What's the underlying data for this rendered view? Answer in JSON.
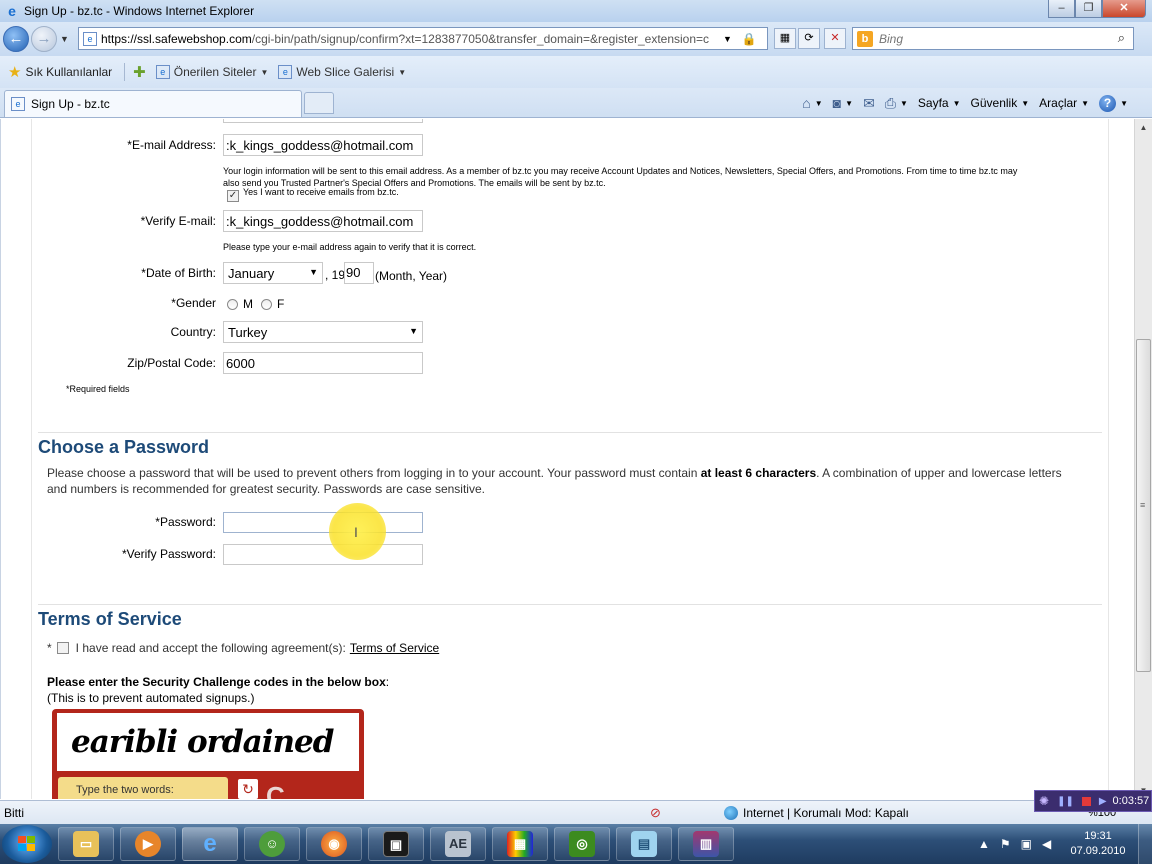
{
  "window": {
    "title": "Sign Up - bz.tc - Windows Internet Explorer",
    "minimize": "‒",
    "restore": "❐",
    "close": "✕"
  },
  "address_bar": {
    "url_host": "https://ssl.safewebshop.com",
    "url_path": "/cgi-bin/path/signup/confirm?xt=1283877050&transfer_domain=&register_extension=c"
  },
  "search": {
    "placeholder": "Bing"
  },
  "favorites_bar": {
    "favorites_label": "Sık Kullanılanlar",
    "links": [
      "Önerilen Siteler",
      "Web Slice Galerisi"
    ]
  },
  "tab": {
    "label": "Sign Up - bz.tc"
  },
  "command_bar": {
    "page_label": "Sayfa",
    "safety_label": "Güvenlik",
    "tools_label": "Araçlar",
    "help_label": "?"
  },
  "form": {
    "email_label": "*E-mail Address:",
    "email_value": ":k_kings_goddess@hotmail.com",
    "email_note": "Your login information will be sent to this email address. As a member of bz.tc you may receive Account Updates and Notices, Newsletters, Special Offers, and Promotions. From time to time bz.tc may also send you Trusted Partner's Special Offers and Promotions. The emails will be sent by bz.tc.",
    "optin_label": "Yes I want to receive emails from bz.tc.",
    "optin_checked": true,
    "verify_email_label": "*Verify E-mail:",
    "verify_email_value": ":k_kings_goddess@hotmail.com",
    "verify_email_note": "Please type your e-mail address again to verify that it is correct.",
    "dob_label": "*Date of Birth:",
    "dob_month": "January",
    "dob_year_prefix": ", 19",
    "dob_year": "90",
    "dob_hint": "(Month, Year)",
    "gender_label": "*Gender",
    "gender_m": "M",
    "gender_f": "F",
    "country_label": "Country:",
    "country_value": "Turkey",
    "zip_label": "Zip/Postal Code:",
    "zip_value": "6000",
    "required_note": "*Required fields"
  },
  "password_section": {
    "heading": "Choose a Password",
    "desc_before": "Please choose a password that will be used to prevent others from logging in to your account. Your password must contain ",
    "desc_bold": "at least 6 characters",
    "desc_after": ". A combination of upper and lowercase letters and numbers is recommended for greatest security. Passwords are case sensitive.",
    "password_label": "*Password:",
    "verify_password_label": "*Verify Password:"
  },
  "tos_section": {
    "heading": "Terms of Service",
    "accept_prefix": "*",
    "accept_label": "I have read and accept the following agreement(s):",
    "tos_link": "Terms of Service",
    "challenge_title": "Please enter the Security Challenge codes in the below box",
    "challenge_colon": ":",
    "challenge_sub": "(This is to prevent automated signups.)",
    "captcha_words": "earibli ordained",
    "captcha_prompt": "Type the two words:"
  },
  "status_bar": {
    "status": "Bitti",
    "zone": "Internet | Korumalı Mod: Kapalı",
    "zoom": "%100"
  },
  "recorder": {
    "time": "0:03:57"
  },
  "taskbar": {
    "time": "19:31",
    "date": "07.09.2010",
    "apps": [
      "explorer",
      "media-player",
      "internet-explorer",
      "messenger",
      "firefox",
      "media-center",
      "after-effects",
      "film-editor",
      "nvidia",
      "notepad",
      "winrar"
    ]
  }
}
